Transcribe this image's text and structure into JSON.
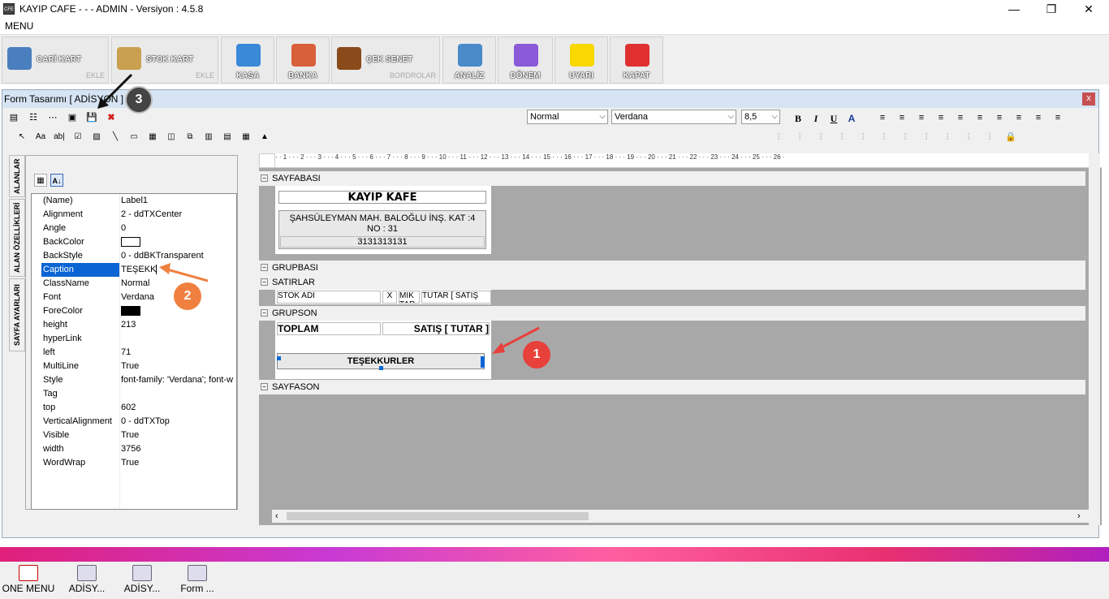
{
  "window": {
    "title": "KAYIP CAFE -  -  - ADMIN -  Versiyon : 4.5.8",
    "minimize": "—",
    "restore": "❐",
    "close": "✕"
  },
  "menu": {
    "label": "MENU"
  },
  "toolbar": [
    {
      "label": "CARİ KART",
      "sub": "EKLE",
      "color": "#4a7fbf"
    },
    {
      "label": "STOK KART",
      "sub": "EKLE",
      "color": "#c8a050"
    },
    {
      "label": "KASA",
      "sub": "",
      "color": "#3a88d8"
    },
    {
      "label": "BANKA",
      "sub": "",
      "color": "#d8603a"
    },
    {
      "label": "ÇEK SENET",
      "sub": "BORDROLAR",
      "color": "#8a4a1a"
    },
    {
      "label": "ANALİZ",
      "sub": "",
      "color": "#4a8ac8"
    },
    {
      "label": "DÖNEM",
      "sub": "",
      "color": "#8a5ad8"
    },
    {
      "label": "UYARI",
      "sub": "",
      "color": "#f8d800"
    },
    {
      "label": "KAPAT",
      "sub": "",
      "color": "#e03030"
    }
  ],
  "form": {
    "title": "Form Tasarımı [ ADİSYON ]",
    "close": "x",
    "style_select": "Normal",
    "font_select": "Verdana",
    "size_select": "8,5",
    "format": {
      "bold": "B",
      "italic": "I",
      "underline": "U",
      "font": "A"
    },
    "side_tabs": [
      "ALANLAR",
      "ALAN ÖZELLİKLERİ",
      "SAYFA AYARLARI"
    ]
  },
  "properties": [
    {
      "name": "(Name)",
      "value": "Label1"
    },
    {
      "name": "Alignment",
      "value": "2 - ddTXCenter"
    },
    {
      "name": "Angle",
      "value": "0"
    },
    {
      "name": "BackColor",
      "value": ""
    },
    {
      "name": "BackStyle",
      "value": "0 - ddBKTransparent"
    },
    {
      "name": "Caption",
      "value": "TEŞEKK"
    },
    {
      "name": "ClassName",
      "value": "Normal"
    },
    {
      "name": "Font",
      "value": "Verdana"
    },
    {
      "name": "ForeColor",
      "value": ""
    },
    {
      "name": "height",
      "value": "213"
    },
    {
      "name": "hyperLink",
      "value": ""
    },
    {
      "name": "left",
      "value": "71"
    },
    {
      "name": "MultiLine",
      "value": "True"
    },
    {
      "name": "Style",
      "value": "font-family: 'Verdana'; font-w"
    },
    {
      "name": "Tag",
      "value": ""
    },
    {
      "name": "top",
      "value": "602"
    },
    {
      "name": "VerticalAlignment",
      "value": "0 - ddTXTop"
    },
    {
      "name": "Visible",
      "value": "True"
    },
    {
      "name": "width",
      "value": "3756"
    },
    {
      "name": "WordWrap",
      "value": "True"
    }
  ],
  "ruler": "· · 1 · · · 2 · · · 3 · · · 4 · · · 5 · · · 6 · · · 7 · · · 8 · · · 9 · · · 10 · · · 11 · · · 12 · · · 13 · · · 14 · · · 15 · · · 16 · · · 17 · · · 18 · · · 19 · · · 20 · · · 21 · · · 22 · · · 23 · · · 24 · · · 25 · · · 26 ·",
  "bands": {
    "pageheader": "SAYFABASI",
    "groupheader": "GRUPBASI",
    "detail": "SATIRLAR",
    "groupfooter": "GRUPSON",
    "pagefooter": "SAYFASON"
  },
  "report": {
    "company": "KAYIP KAFE",
    "address": "ŞAHSÜLEYMAN MAH. BALOĞLU İNŞ. KAT :4 NO : 31",
    "phone": "3131313131",
    "col_stok": "STOK ADI",
    "col_x": "X",
    "col_mik": "MİK TAR",
    "col_tutar": "TUTAR [ SATIŞ",
    "total_label": "TOPLAM",
    "total_value": "SATIŞ [ TUTAR ]",
    "thanks": "TEŞEKKURLER"
  },
  "annotations": [
    "1",
    "2",
    "3"
  ],
  "taskbar": [
    "ONE MENU",
    "ADİSY...",
    "ADİSY...",
    "Form ..."
  ],
  "colors": {
    "annot_red": "#e8403a",
    "annot_orange": "#f08040",
    "annot_dark": "#333333",
    "accent_blue": "#0a64d4"
  }
}
